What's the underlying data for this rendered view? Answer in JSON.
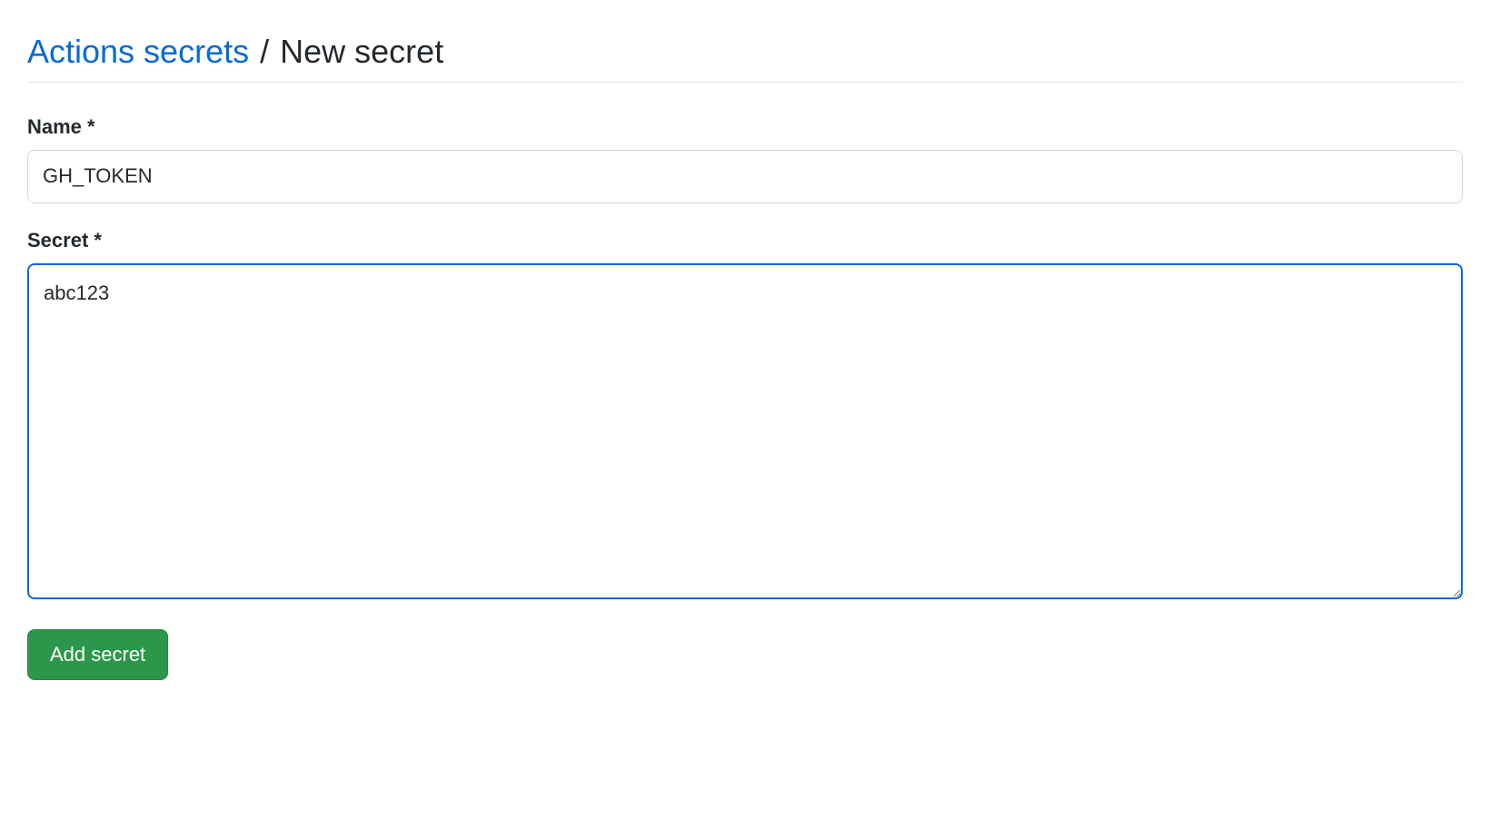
{
  "breadcrumb": {
    "parent": "Actions secrets",
    "separator": "/",
    "current": "New secret"
  },
  "form": {
    "name_label": "Name *",
    "name_value": "GH_TOKEN",
    "secret_label": "Secret *",
    "secret_value": "abc123",
    "submit_label": "Add secret"
  }
}
